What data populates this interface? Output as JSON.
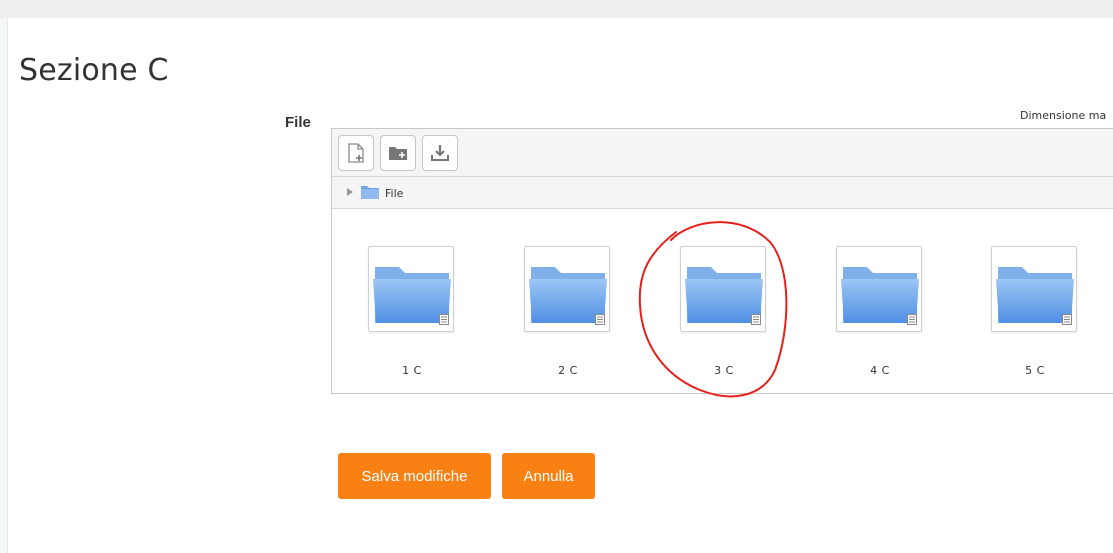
{
  "section": {
    "title": "Sezione C"
  },
  "field": {
    "label": "File",
    "max_size_text": "Dimensione ma"
  },
  "toolbar": {
    "buttons": [
      {
        "icon": "add-file-icon"
      },
      {
        "icon": "create-folder-icon"
      },
      {
        "icon": "download-icon"
      }
    ]
  },
  "path": {
    "label": "File",
    "icon": "folder-icon"
  },
  "folders": [
    {
      "name": "1 C",
      "icon": "folder-icon"
    },
    {
      "name": "2 C",
      "icon": "folder-icon"
    },
    {
      "name": "3 C",
      "icon": "folder-icon"
    },
    {
      "name": "4 C",
      "icon": "folder-icon"
    },
    {
      "name": "5 C",
      "icon": "folder-icon"
    }
  ],
  "actions": {
    "save_label": "Salva modifiche",
    "cancel_label": "Annulla"
  },
  "colors": {
    "accent": "#f98012",
    "annotation": "#e8201c",
    "folder": "#6fa2e6"
  }
}
